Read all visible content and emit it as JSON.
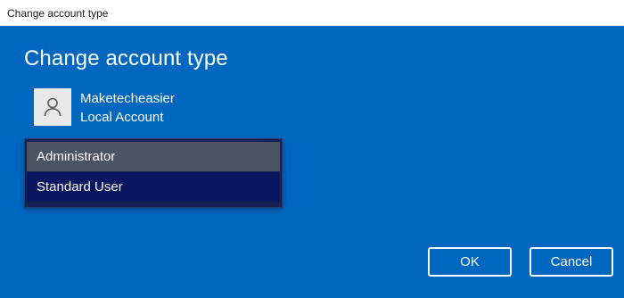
{
  "window": {
    "title": "Change account type"
  },
  "main": {
    "heading": "Change account type",
    "user": {
      "name": "Maketecheasier",
      "account_kind": "Local Account",
      "avatar_icon": "person-icon"
    },
    "account_type_dropdown": {
      "options": [
        "Administrator",
        "Standard User"
      ],
      "hovered": "Administrator",
      "selected": "Standard User"
    }
  },
  "footer": {
    "ok_label": "OK",
    "cancel_label": "Cancel"
  },
  "colors": {
    "background": "#0067c0",
    "titlebar": "#ffffff",
    "dropdown_hover": "#4b5462",
    "dropdown_selected": "#0b1660"
  }
}
